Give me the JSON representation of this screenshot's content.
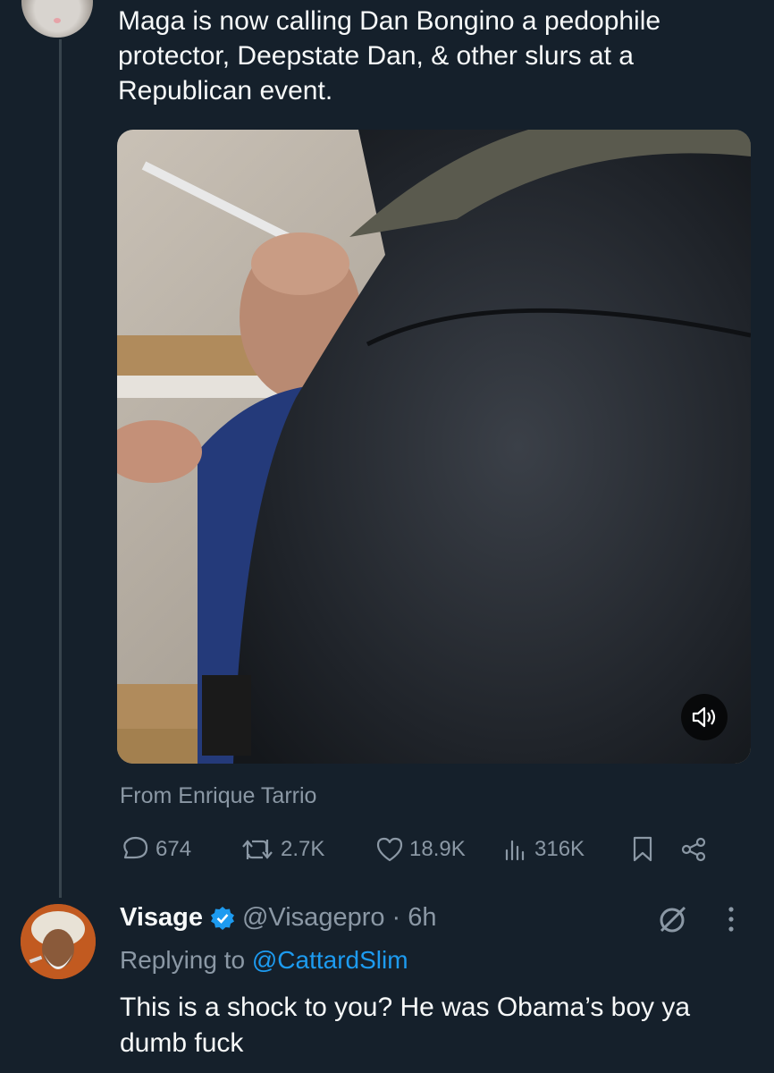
{
  "tweet": {
    "text": "Maga is now calling Dan Bongino a pedophile protector, Deepstate Dan, & other slurs at a Republican event.",
    "source_label": "From Enrique Tarrio",
    "stats": {
      "replies": "674",
      "retweets": "2.7K",
      "likes": "18.9K",
      "views": "316K"
    },
    "icons": [
      "reply-icon",
      "retweet-icon",
      "like-icon",
      "views-icon",
      "bookmark-icon",
      "share-icon",
      "sound-icon"
    ]
  },
  "reply": {
    "name": "Visage",
    "handle": "@Visagepro",
    "time": "· 6h",
    "replying_prefix": "Replying to",
    "replying_to": "@CattardSlim",
    "text": "This is a shock to you? He was Obama’s boy ya dumb fuck",
    "icons": [
      "verified-badge-icon",
      "grok-icon",
      "more-icon"
    ]
  },
  "colors": {
    "background": "#15202b",
    "text": "#f7f9f9",
    "muted": "#8b98a5",
    "accent": "#1d9bf0"
  }
}
